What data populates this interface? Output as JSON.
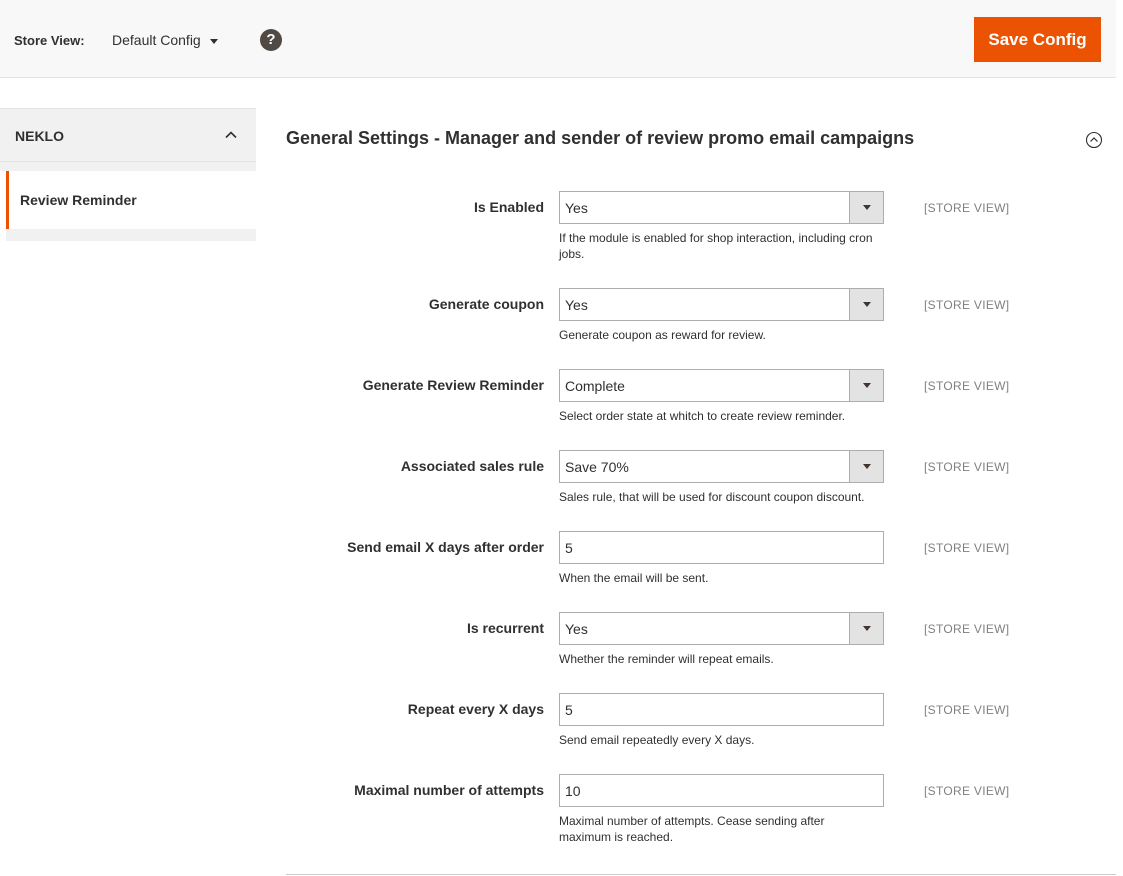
{
  "header": {
    "store_view_label": "Store View:",
    "store_view_value": "Default Config",
    "help_icon": "?",
    "save_label": "Save Config"
  },
  "sidebar": {
    "group_title": "NEKLO",
    "items": [
      {
        "label": "Review Reminder",
        "active": true
      }
    ]
  },
  "section": {
    "title": "General Settings - Manager and sender of review promo email campaigns"
  },
  "fields": [
    {
      "label": "Is Enabled",
      "type": "select",
      "value": "Yes",
      "note": "If the module is enabled for shop interaction, including cron jobs.",
      "scope": "[STORE VIEW]"
    },
    {
      "label": "Generate coupon",
      "type": "select",
      "value": "Yes",
      "note": "Generate coupon as reward for review.",
      "scope": "[STORE VIEW]"
    },
    {
      "label": "Generate Review Reminder",
      "type": "select",
      "value": "Complete",
      "note": "Select order state at whitch to create review reminder.",
      "scope": "[STORE VIEW]"
    },
    {
      "label": "Associated sales rule",
      "type": "select",
      "value": "Save 70%",
      "note": "Sales rule, that will be used for discount coupon discount.",
      "scope": "[STORE VIEW]"
    },
    {
      "label": "Send email X days after order",
      "type": "text",
      "value": "5",
      "note": "When the email will be sent.",
      "scope": "[STORE VIEW]"
    },
    {
      "label": "Is recurrent",
      "type": "select",
      "value": "Yes",
      "note": "Whether the reminder will repeat emails.",
      "scope": "[STORE VIEW]"
    },
    {
      "label": "Repeat every X days",
      "type": "text",
      "value": "5",
      "note": "Send email repeatedly every X days.",
      "scope": "[STORE VIEW]"
    },
    {
      "label": "Maximal number of attempts",
      "type": "text",
      "value": "10",
      "note": "Maximal number of attempts. Cease sending after maximum is reached.",
      "scope": "[STORE VIEW]"
    }
  ],
  "colors": {
    "accent": "#eb5202",
    "help_icon_bg": "#514943",
    "scope_text": "#808080"
  },
  "icons": {
    "help": "help-icon",
    "sidebar_toggle": "chevron-up-icon",
    "section_toggle": "collapse-circle-icon",
    "select_arrow": "caret-down-icon"
  }
}
